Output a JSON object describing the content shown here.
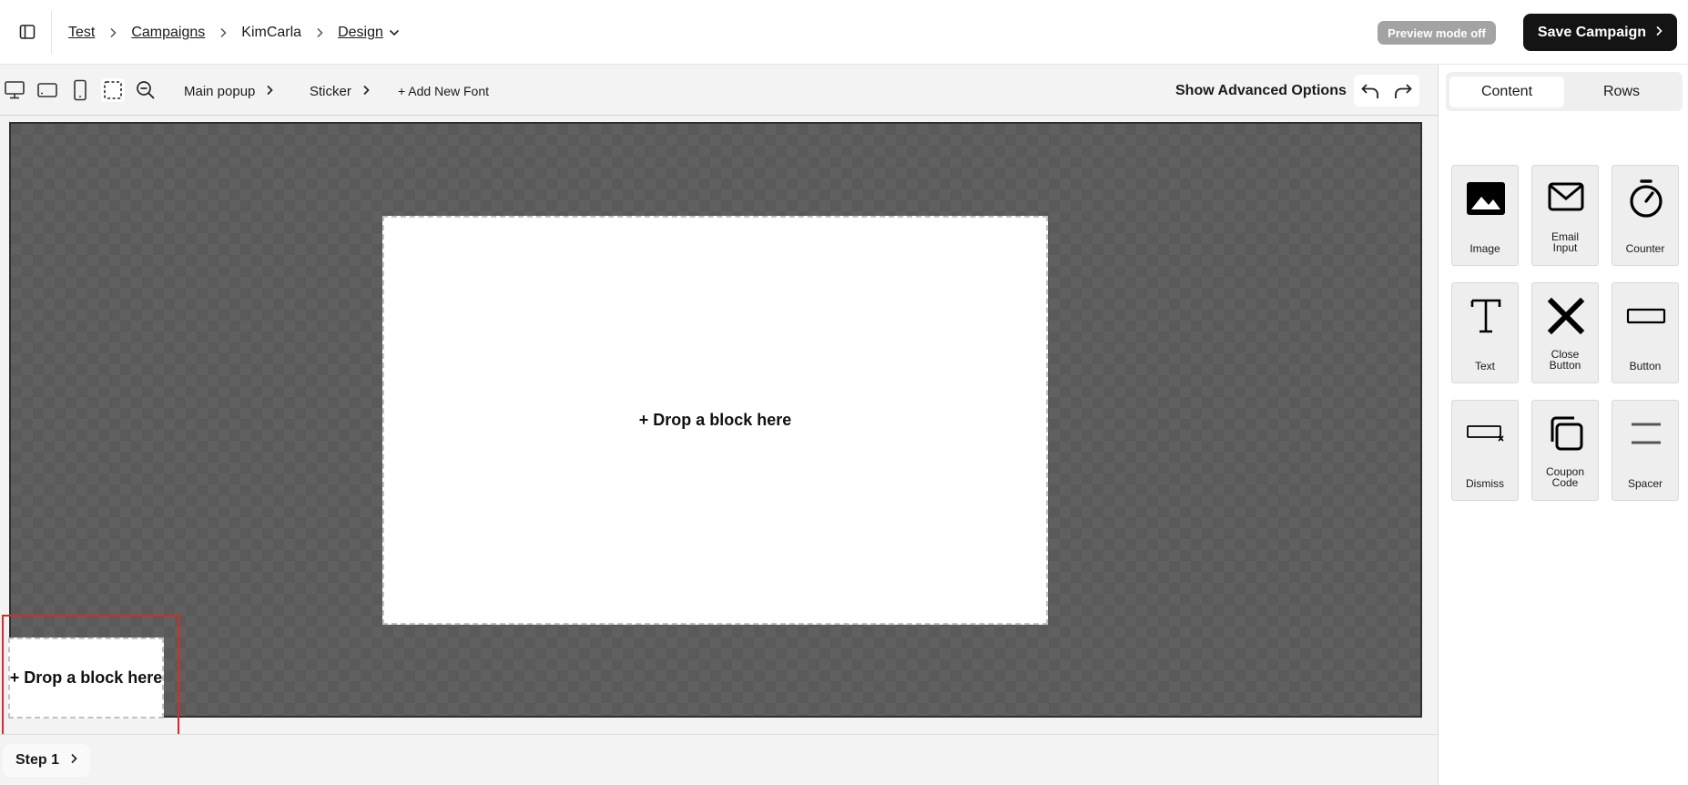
{
  "header": {
    "breadcrumb": {
      "test": "Test",
      "campaigns": "Campaigns",
      "name": "KimCarla",
      "design": "Design"
    },
    "preview_mode": "Preview mode off",
    "save_label": "Save Campaign"
  },
  "toolbar": {
    "devices": [
      "desktop-icon",
      "tablet-landscape-icon",
      "mobile-icon"
    ],
    "crumbs": {
      "main_popup": "Main popup",
      "sticker": "Sticker"
    },
    "add_font": "+ Add New Font",
    "advanced": "Show Advanced Options"
  },
  "canvas": {
    "popup_drop": "+ Drop a block here",
    "sticker_drop": "+ Drop a block here",
    "highlight_color": "#d62b2b"
  },
  "steps": {
    "current": "Step 1"
  },
  "panel": {
    "tabs": {
      "content": "Content",
      "rows": "Rows"
    },
    "blocks": {
      "image": "Image",
      "email_line1": "Email",
      "email_line2": "Input",
      "counter": "Counter",
      "text": "Text",
      "close_line1": "Close",
      "close_line2": "Button",
      "button": "Button",
      "dismiss": "Dismiss",
      "coupon_line1": "Coupon",
      "coupon_line2": "Code",
      "spacer": "Spacer"
    }
  },
  "colors": {
    "save_bg": "#141414",
    "preview_badge": "#a3a3a3",
    "canvas_bg": "#5a5a5a"
  }
}
